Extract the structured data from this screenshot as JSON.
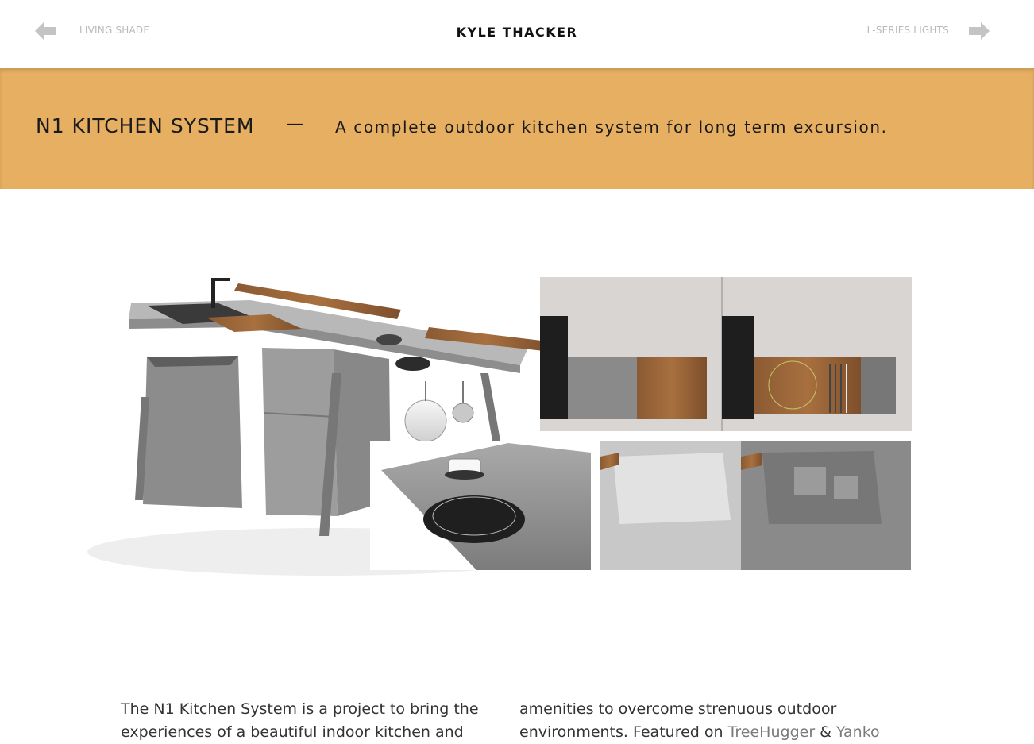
{
  "nav": {
    "prev_label": "LIVING SHADE",
    "next_label": "L-SERIES LIGHTS",
    "site_title": "KYLE THACKER",
    "prev_icon": "arrow-left-icon",
    "next_icon": "arrow-right-icon"
  },
  "banner": {
    "title": "N1 KITCHEN SYSTEM",
    "separator": "—",
    "subtitle": "A complete outdoor kitchen system for long term excursion.",
    "color": "#e6af61"
  },
  "description": {
    "left": "The N1 Kitchen System is a project to bring the experiences of a beautiful indoor kitchen and",
    "right_prefix": "amenities to overcome strenuous outdoor environments. Featured on ",
    "link1": "TreeHugger",
    "amp": " & ",
    "link2": "Yanko"
  }
}
